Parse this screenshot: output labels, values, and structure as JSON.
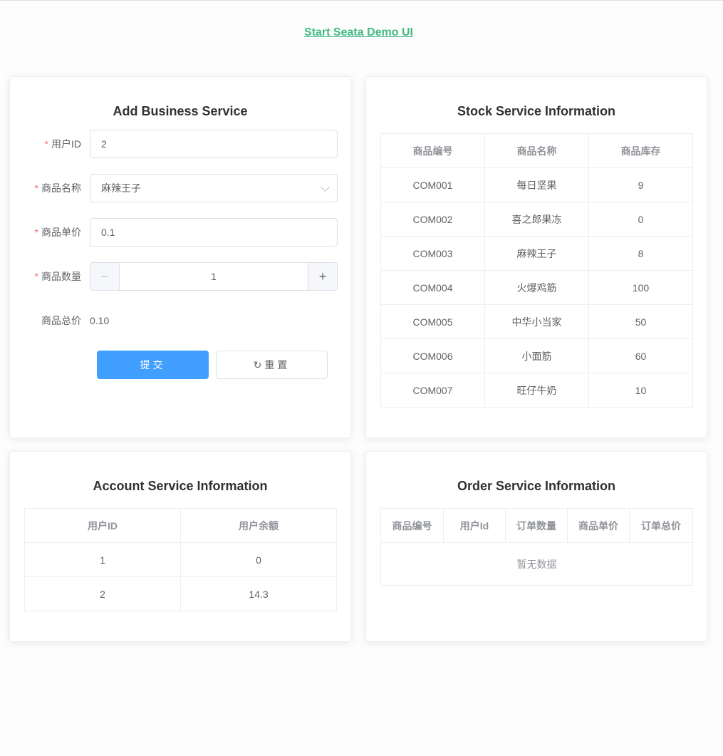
{
  "header": {
    "link_text": "Start Seata Demo UI"
  },
  "business": {
    "title": "Add Business Service",
    "user_id": {
      "label": "用户ID",
      "value": "2"
    },
    "product_name": {
      "label": "商品名称",
      "value": "麻辣王子"
    },
    "unit_price": {
      "label": "商品单价",
      "value": "0.1"
    },
    "quantity": {
      "label": "商品数量",
      "value": "1",
      "minus": "−",
      "plus": "+"
    },
    "total": {
      "label": "商品总价",
      "value": "0.10"
    },
    "submit_label": "提交",
    "reset_label": "重置",
    "reset_icon": "↻"
  },
  "stock": {
    "title": "Stock Service Information",
    "columns": [
      "商品编号",
      "商品名称",
      "商品库存"
    ],
    "rows": [
      [
        "COM001",
        "每日坚果",
        "9"
      ],
      [
        "COM002",
        "喜之郎果冻",
        "0"
      ],
      [
        "COM003",
        "麻辣王子",
        "8"
      ],
      [
        "COM004",
        "火爆鸡筋",
        "100"
      ],
      [
        "COM005",
        "中华小当家",
        "50"
      ],
      [
        "COM006",
        "小面筋",
        "60"
      ],
      [
        "COM007",
        "旺仔牛奶",
        "10"
      ]
    ]
  },
  "account": {
    "title": "Account Service Information",
    "columns": [
      "用户ID",
      "用户余额"
    ],
    "rows": [
      [
        "1",
        "0"
      ],
      [
        "2",
        "14.3"
      ]
    ]
  },
  "order": {
    "title": "Order Service Information",
    "columns": [
      "商品编号",
      "用户Id",
      "订单数量",
      "商品单价",
      "订单总价"
    ],
    "empty_text": "暂无数据"
  },
  "colors": {
    "accent": "#42b983",
    "primary": "#409eff",
    "required": "#f56c6c"
  }
}
